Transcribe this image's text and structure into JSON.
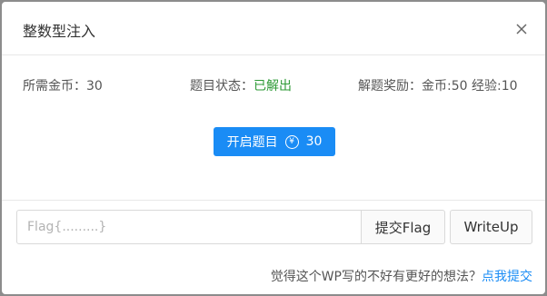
{
  "modal": {
    "title": "整数型注入",
    "close_icon": "close-icon"
  },
  "info": {
    "cost_label": "所需金币：",
    "cost_value": "30",
    "status_label": "题目状态：",
    "status_value": "已解出",
    "status_color": "#2e9a36",
    "reward_label": "解题奖励：",
    "reward_value": "金币:50 经验:10"
  },
  "start_button": {
    "label": "开启题目",
    "coin_icon": "¥",
    "cost": "30",
    "color": "#1a8cf5"
  },
  "flag": {
    "placeholder": "Flag{.........}",
    "value": "",
    "submit_label": "提交Flag",
    "writeup_label": "WriteUp"
  },
  "footer": {
    "question": "觉得这个WP写的不好有更好的想法？",
    "link": "点我提交",
    "link_color": "#1a8cf5"
  }
}
